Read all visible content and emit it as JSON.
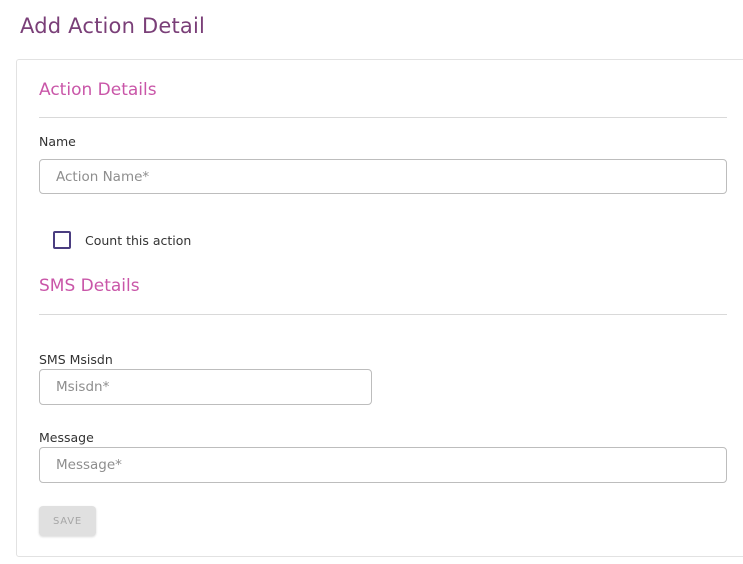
{
  "page": {
    "title": "Add Action Detail"
  },
  "action_details": {
    "section_title": "Action Details",
    "name_label": "Name",
    "name_placeholder": "Action Name*",
    "name_value": "",
    "count_checkbox_label": "Count this action",
    "count_checked": false
  },
  "sms_details": {
    "section_title": "SMS Details",
    "msisdn_label": "SMS Msisdn",
    "msisdn_placeholder": "Msisdn*",
    "msisdn_value": "",
    "message_label": "Message",
    "message_placeholder": "Message*",
    "message_value": ""
  },
  "actions": {
    "save_label": "SAVE",
    "save_enabled": false
  },
  "colors": {
    "page_title": "#7a3f78",
    "section_title": "#c956a8",
    "checkbox_border": "#4a3d80",
    "disabled_button_bg": "#e0e0e0"
  }
}
